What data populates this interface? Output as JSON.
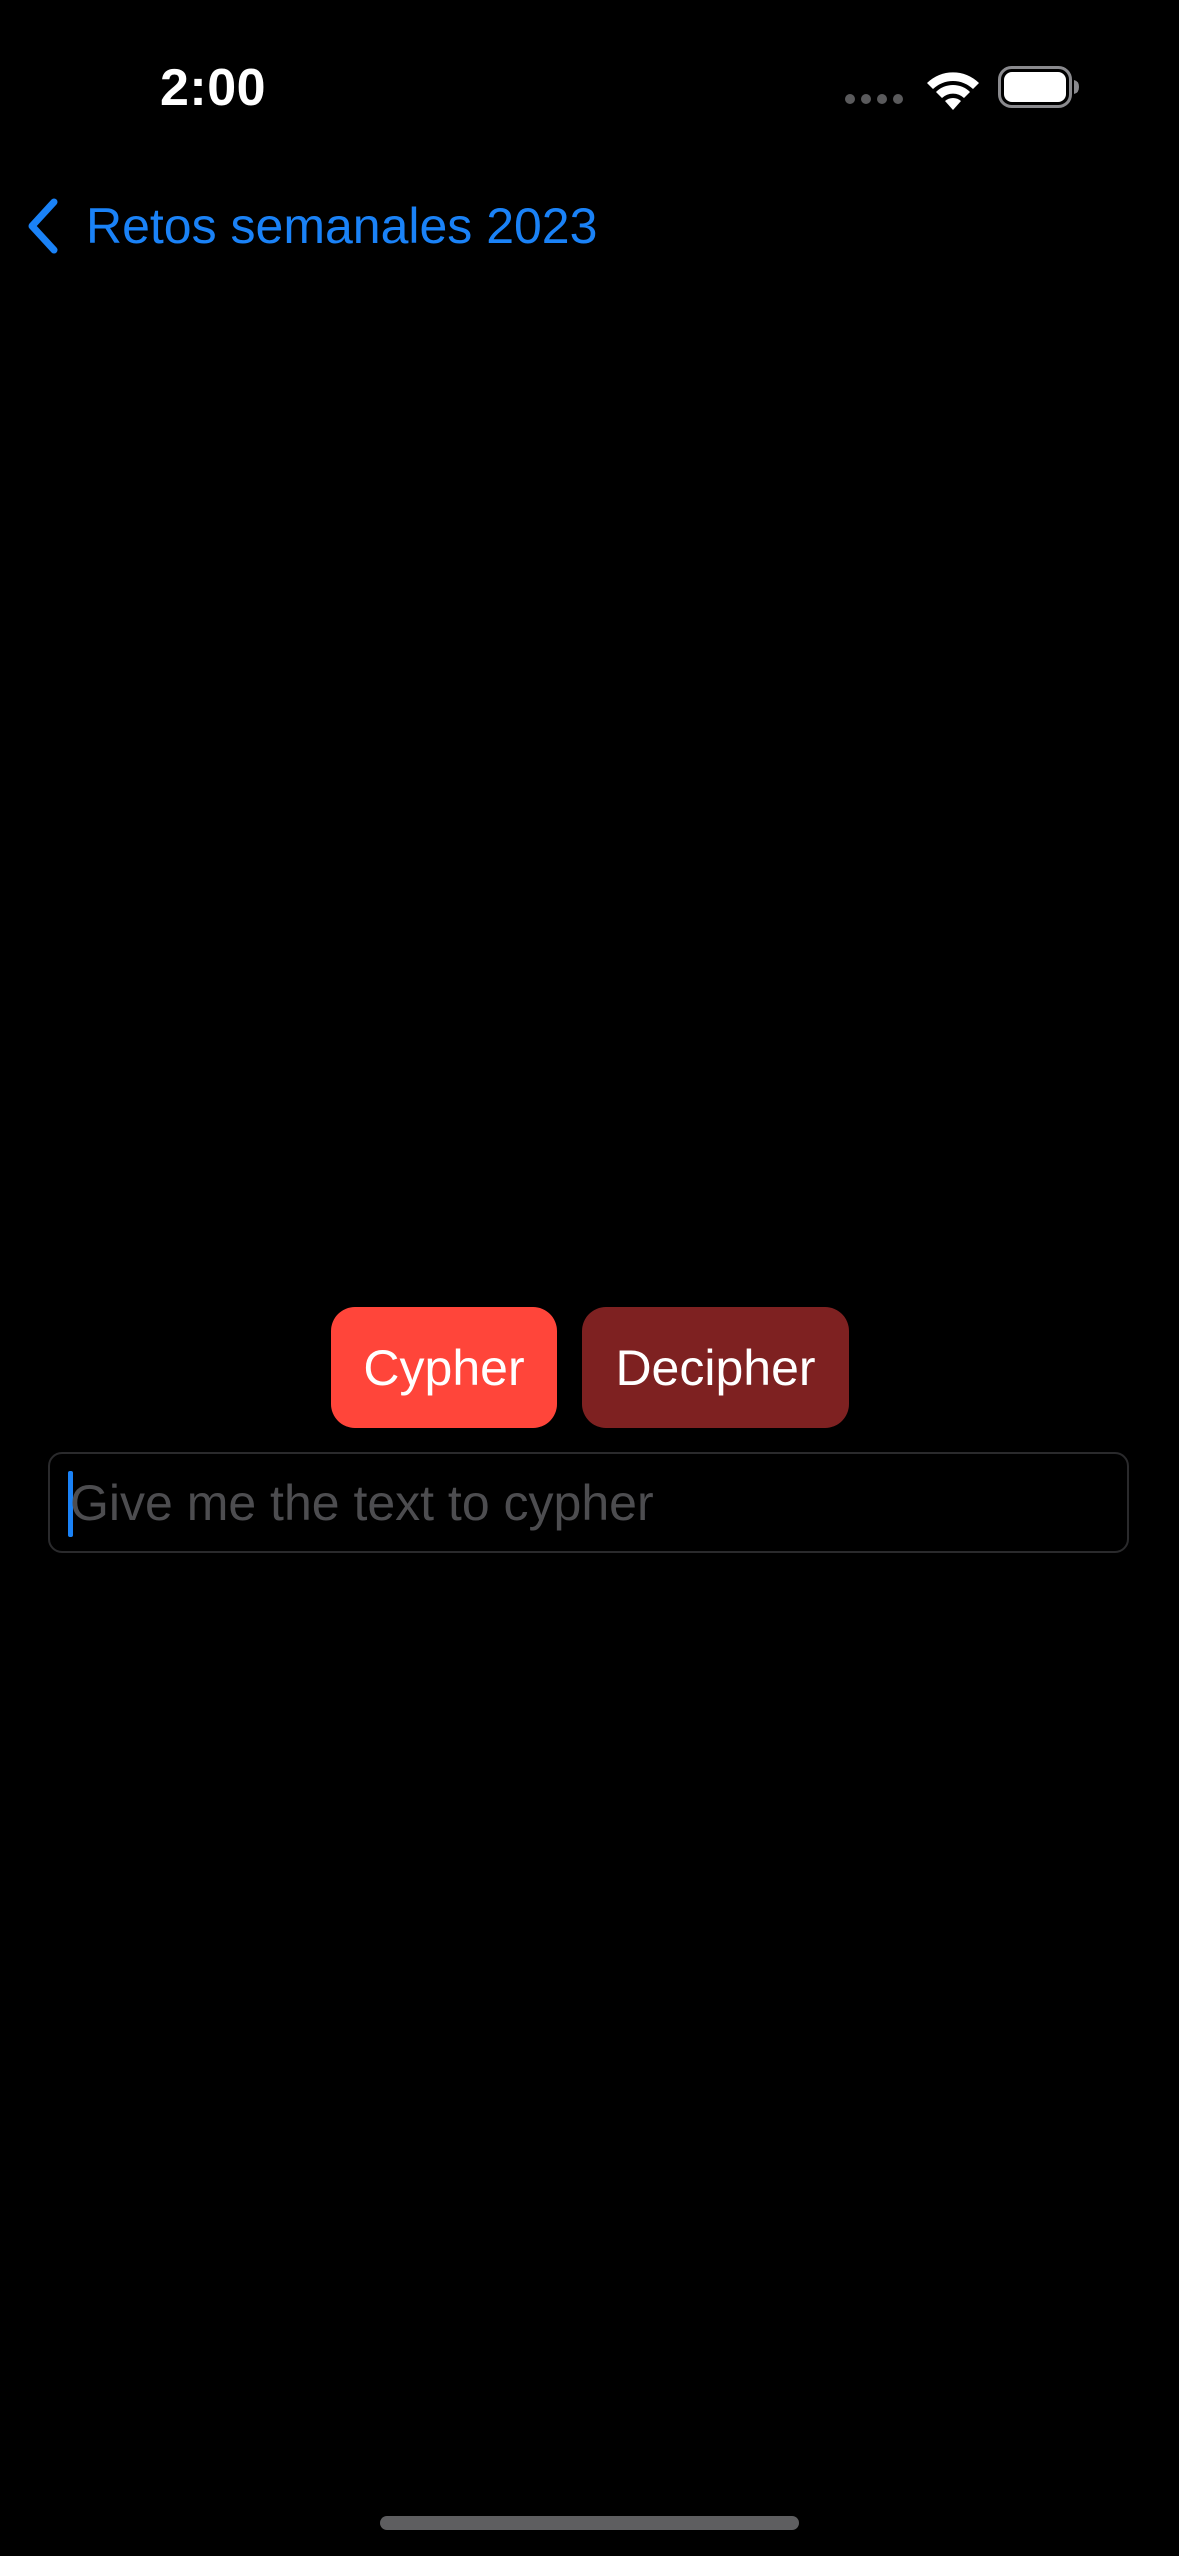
{
  "status_bar": {
    "time": "2:00",
    "icons": [
      "cellular-signal-icon",
      "wifi-icon",
      "battery-icon"
    ]
  },
  "navigation": {
    "back_label": "Retos semanales 2023",
    "back_icon": "chevron-left-icon"
  },
  "actions": {
    "cypher_label": "Cypher",
    "decipher_label": "Decipher"
  },
  "input": {
    "placeholder": "Give me the text to cypher",
    "value": ""
  },
  "colors": {
    "background": "#000000",
    "accent": "#1a82f7",
    "cypher_button": "#ff453a",
    "decipher_button": "#7e2121",
    "placeholder_text": "#4d4d50"
  }
}
